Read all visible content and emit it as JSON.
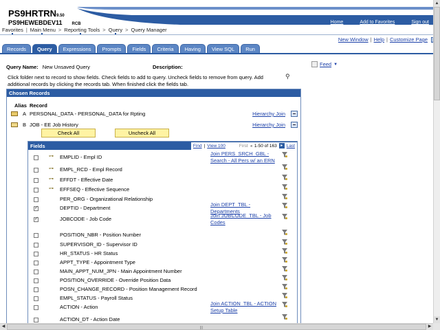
{
  "header": {
    "app_name": "PS9HRTRN",
    "app_version": "9.50",
    "database": "PS9HEWEBDEV11",
    "user": "RCB",
    "links": [
      "Home",
      "Add to Favorites",
      "Sign out"
    ]
  },
  "breadcrumb": [
    "Favorites",
    "Main Menu",
    "Reporting Tools",
    "Query",
    "Query Manager"
  ],
  "top_links": [
    "New Window",
    "Help",
    "Customize Page"
  ],
  "tabs": [
    "Records",
    "Query",
    "Expressions",
    "Prompts",
    "Fields",
    "Criteria",
    "Having",
    "View SQL",
    "Run"
  ],
  "active_tab": "Query",
  "query": {
    "name_label": "Query Name:",
    "name_value": "New Unsaved Query",
    "description_label": "Description:",
    "feed_label": "Feed",
    "instructions": "Click folder next to record to show fields. Check fields to add to query. Uncheck fields to remove from query. Add additional records by clicking the records tab. When finished click the fields tab."
  },
  "chosen_records": {
    "title": "Chosen Records",
    "col_alias": "Alias",
    "col_record": "Record",
    "records": [
      {
        "alias": "A",
        "name": "PERSONAL_DATA - PERSONAL_DATA for Rpting",
        "link": "Hierarchy Join"
      },
      {
        "alias": "B",
        "name": "JOB - EE Job History",
        "link": "Hierarchy Join"
      }
    ],
    "check_all": "Check All",
    "uncheck_all": "Uncheck All"
  },
  "fields_panel": {
    "title": "Fields",
    "find": "Find",
    "view": "View 100",
    "first": "First",
    "range": "1-50 of 163",
    "last": "Last",
    "rows": [
      {
        "name": "EMPLID - Empl ID",
        "checked": false,
        "key": true,
        "join": "Join PERS_SRCH_GBL - Search - All Pers w/ an ERN"
      },
      {
        "name": "EMPL_RCD - Empl Record",
        "checked": false,
        "key": true,
        "join": ""
      },
      {
        "name": "EFFDT - Effective Date",
        "checked": false,
        "key": true,
        "join": ""
      },
      {
        "name": "EFFSEQ - Effective Sequence",
        "checked": false,
        "key": true,
        "join": ""
      },
      {
        "name": "PER_ORG - Organizational Relationship",
        "checked": false,
        "key": false,
        "join": ""
      },
      {
        "name": "DEPTID - Department",
        "checked": true,
        "key": false,
        "join": "Join DEPT_TBL - Departments"
      },
      {
        "name": "JOBCODE - Job Code",
        "checked": true,
        "key": false,
        "join": "Join JOBCODE_TBL - Job Codes"
      },
      {
        "name": "POSITION_NBR - Position Number",
        "checked": false,
        "key": false,
        "join": ""
      },
      {
        "name": "SUPERVISOR_ID - Supervisor ID",
        "checked": false,
        "key": false,
        "join": ""
      },
      {
        "name": "HR_STATUS - HR Status",
        "checked": false,
        "key": false,
        "join": ""
      },
      {
        "name": "APPT_TYPE - Appointment Type",
        "checked": false,
        "key": false,
        "join": ""
      },
      {
        "name": "MAIN_APPT_NUM_JPN - Main Appointment Number",
        "checked": false,
        "key": false,
        "join": ""
      },
      {
        "name": "POSITION_OVERRIDE - Override Position Data",
        "checked": false,
        "key": false,
        "join": ""
      },
      {
        "name": "POSN_CHANGE_RECORD - Position Management Record",
        "checked": false,
        "key": false,
        "join": ""
      },
      {
        "name": "EMPL_STATUS - Payroll Status",
        "checked": false,
        "key": false,
        "join": ""
      },
      {
        "name": "ACTION - Action",
        "checked": false,
        "key": false,
        "join": "Join ACTION_TBL - ACTION Setup Table"
      },
      {
        "name": "ACTION_DT - Action Date",
        "checked": false,
        "key": false,
        "join": ""
      }
    ]
  },
  "colors": {
    "accent": "#2c5ca3",
    "tab": "#5c86c4",
    "button_yellow": "#fff3a3",
    "link": "#1a3fa8"
  }
}
